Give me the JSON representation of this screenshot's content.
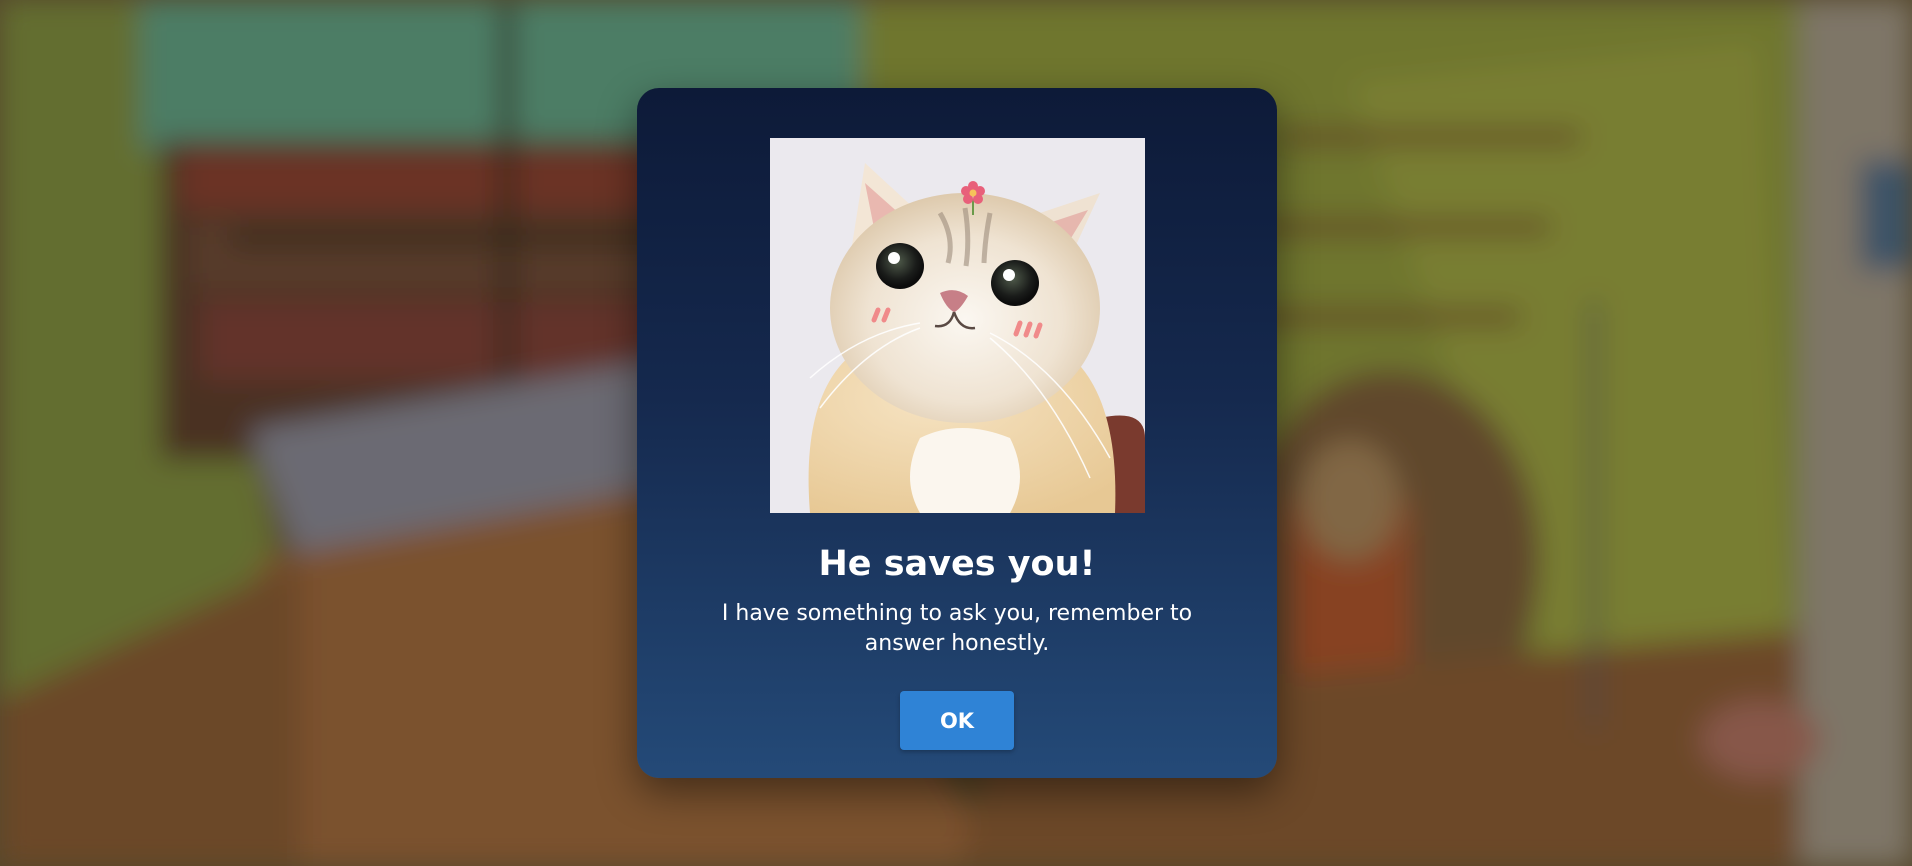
{
  "background": {
    "description_icon": "blurred-illustrated-room-icon"
  },
  "dialog": {
    "image_icon": "cat-photo-icon",
    "title": "He saves you!",
    "message": "I have something to ask you, remember to answer honestly.",
    "ok_label": "OK"
  },
  "colors": {
    "dialog_top": "#0d1a38",
    "dialog_bottom": "#244a78",
    "button": "#2f83d6",
    "text": "#ffffff"
  }
}
